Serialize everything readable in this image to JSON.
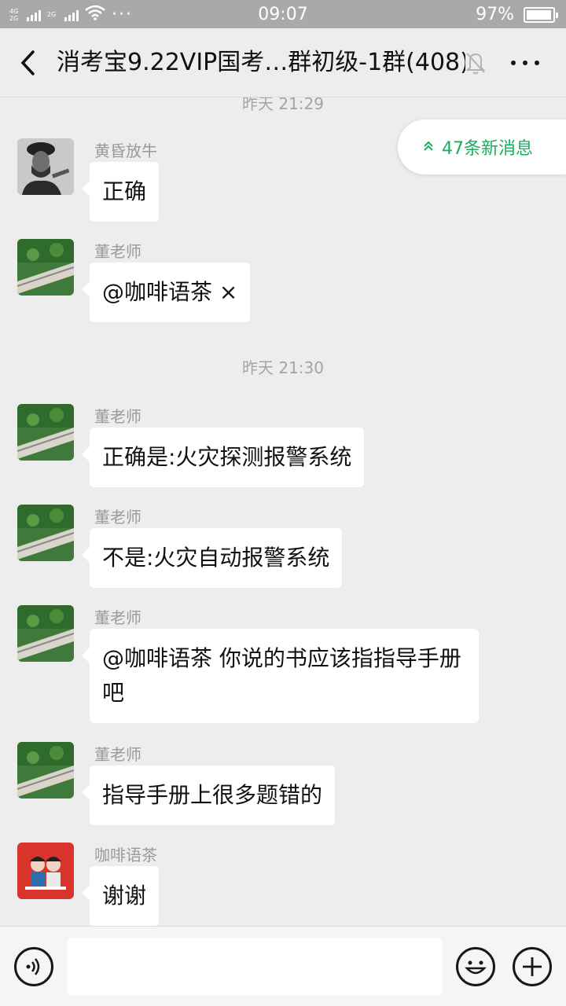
{
  "status_bar": {
    "network_top": "4G",
    "network_bottom": "2G",
    "network_second": "2G",
    "time": "09:07",
    "battery": "97%"
  },
  "title_bar": {
    "title": "消考宝9.22VIP国考…群初级-1群(408)",
    "back_icon": "chevron-left-icon",
    "mute_icon": "bell-off-icon",
    "more_icon": "more-icon"
  },
  "new_messages": {
    "label": "47条新消息",
    "icon": "double-chevron-up-icon"
  },
  "timestamps": [
    "昨天 21:29",
    "昨天 21:30"
  ],
  "messages": [
    {
      "sender": "黄昏放牛",
      "text": "正确",
      "avatar": "man-portrait"
    },
    {
      "sender": "董老师",
      "text": "@咖啡语茶 ×",
      "avatar": "landscape"
    },
    {
      "sender": "董老师",
      "text": "正确是:火灾探测报警系统",
      "avatar": "landscape"
    },
    {
      "sender": "董老师",
      "text": "不是:火灾自动报警系统",
      "avatar": "landscape"
    },
    {
      "sender": "董老师",
      "text": "@咖啡语茶   你说的书应该指指导手册吧",
      "avatar": "landscape"
    },
    {
      "sender": "董老师",
      "text": "指导手册上很多题错的",
      "avatar": "landscape"
    },
    {
      "sender": "咖啡语茶",
      "text": "谢谢",
      "avatar": "couple-red"
    }
  ],
  "input_bar": {
    "voice_icon": "voice-icon",
    "emoji_icon": "emoji-icon",
    "plus_icon": "plus-icon",
    "placeholder": ""
  },
  "colors": {
    "accent_green": "#1aad5c",
    "background": "#ededed",
    "status_bar": "#a9a9a9"
  }
}
